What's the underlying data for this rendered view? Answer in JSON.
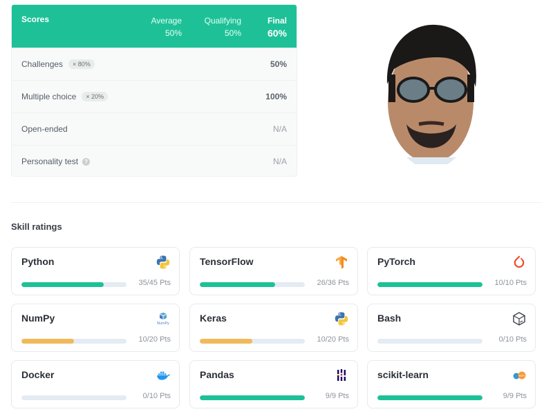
{
  "scores": {
    "title": "Scores",
    "columns": [
      {
        "label": "Average",
        "value": "50%"
      },
      {
        "label": "Qualifying",
        "value": "50%"
      },
      {
        "label": "Final",
        "value": "60%"
      }
    ],
    "rows": [
      {
        "name": "Challenges",
        "weight": "× 80%",
        "value": "50%"
      },
      {
        "name": "Multiple choice",
        "weight": "× 20%",
        "value": "100%"
      },
      {
        "name": "Open-ended",
        "value": "N/A"
      },
      {
        "name": "Personality test",
        "value": "N/A"
      }
    ]
  },
  "skills": {
    "title": "Skill ratings",
    "colors": {
      "green": "#1ec197",
      "orange": "#f0b95a",
      "track": "#e5ebf3"
    },
    "items": [
      {
        "name": "Python",
        "pts": "35/45 Pts",
        "fraction": 0.78,
        "color": "#1ec197",
        "icon": "python-icon"
      },
      {
        "name": "TensorFlow",
        "pts": "26/36 Pts",
        "fraction": 0.72,
        "color": "#1ec197",
        "icon": "tensorflow-icon"
      },
      {
        "name": "PyTorch",
        "pts": "10/10 Pts",
        "fraction": 1.0,
        "color": "#1ec197",
        "icon": "pytorch-icon"
      },
      {
        "name": "NumPy",
        "pts": "10/20 Pts",
        "fraction": 0.5,
        "color": "#f0b95a",
        "icon": "numpy-icon"
      },
      {
        "name": "Keras",
        "pts": "10/20 Pts",
        "fraction": 0.5,
        "color": "#f0b95a",
        "icon": "python-icon"
      },
      {
        "name": "Bash",
        "pts": "0/10 Pts",
        "fraction": 0,
        "color": "#1ec197",
        "icon": "bash-icon"
      },
      {
        "name": "Docker",
        "pts": "0/10 Pts",
        "fraction": 0,
        "color": "#1ec197",
        "icon": "docker-icon"
      },
      {
        "name": "Pandas",
        "pts": "9/9 Pts",
        "fraction": 1.0,
        "color": "#1ec197",
        "icon": "pandas-icon"
      },
      {
        "name": "scikit-learn",
        "pts": "9/9 Pts",
        "fraction": 1.0,
        "color": "#1ec197",
        "icon": "scikit-learn-icon"
      }
    ]
  }
}
